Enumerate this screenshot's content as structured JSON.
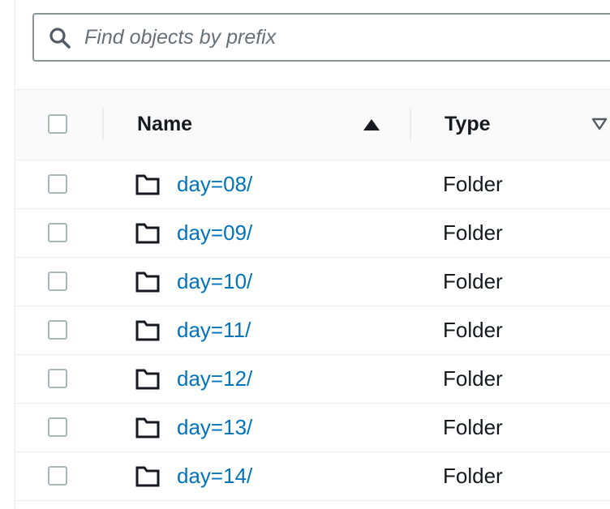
{
  "search": {
    "placeholder": "Find objects by prefix",
    "value": ""
  },
  "table": {
    "columns": [
      {
        "label": "Name",
        "sort": "ascending"
      },
      {
        "label": "Type",
        "sort": "none"
      }
    ],
    "rows": [
      {
        "name": "day=08/",
        "type": "Folder",
        "selected": false
      },
      {
        "name": "day=09/",
        "type": "Folder",
        "selected": false
      },
      {
        "name": "day=10/",
        "type": "Folder",
        "selected": false
      },
      {
        "name": "day=11/",
        "type": "Folder",
        "selected": false
      },
      {
        "name": "day=12/",
        "type": "Folder",
        "selected": false
      },
      {
        "name": "day=13/",
        "type": "Folder",
        "selected": false
      },
      {
        "name": "day=14/",
        "type": "Folder",
        "selected": false
      }
    ]
  },
  "icons": {
    "search": "search-icon",
    "folder": "folder-icon",
    "sort_ascending": "sort-ascending-icon",
    "sort_unsorted": "sort-unsorted-icon"
  },
  "colors": {
    "link": "#0073bb",
    "text": "#16191f",
    "border": "#eaeded",
    "input_border": "#879596",
    "checkbox_border": "#aab7b8"
  }
}
